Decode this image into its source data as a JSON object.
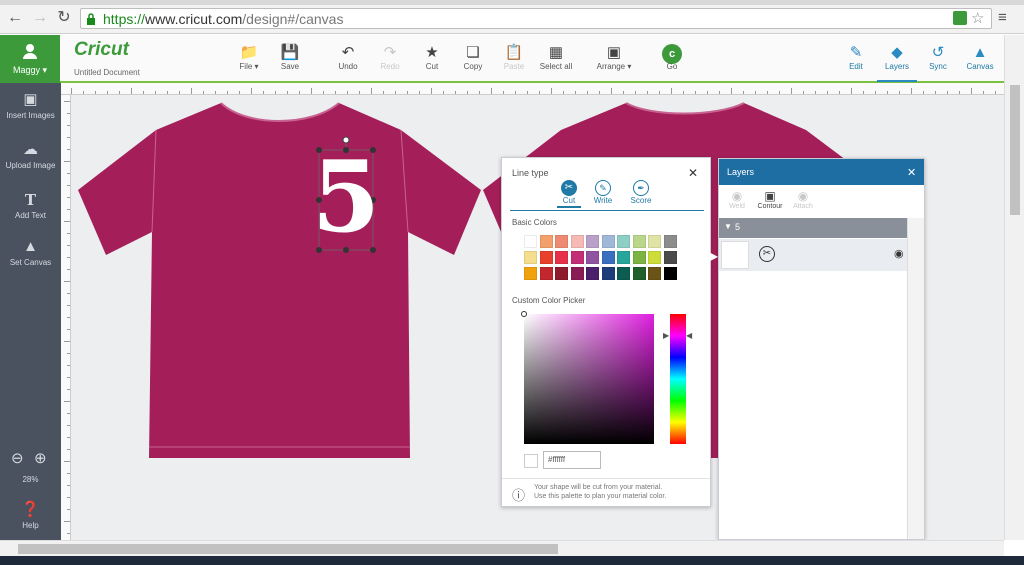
{
  "browser": {
    "back_icon": "back-arrow-icon",
    "forward_icon": "forward-arrow-icon",
    "reload_icon": "reload-icon",
    "url_scheme": "https://",
    "url_host": "www.cricut.com",
    "url_path": "/design#/canvas"
  },
  "header": {
    "user_name": "Maggy",
    "logo": "Cricut",
    "document_title": "Untitled Document",
    "toolbar": [
      {
        "label": "File",
        "icon": "folder-icon"
      },
      {
        "label": "Save",
        "icon": "save-icon"
      },
      {
        "label": "Undo",
        "icon": "undo-icon"
      },
      {
        "label": "Redo",
        "icon": "redo-icon"
      },
      {
        "label": "Cut",
        "icon": "cut-icon"
      },
      {
        "label": "Copy",
        "icon": "copy-icon"
      },
      {
        "label": "Paste",
        "icon": "paste-icon"
      },
      {
        "label": "Select all",
        "icon": "select-all-icon"
      },
      {
        "label": "Arrange",
        "icon": "arrange-icon"
      },
      {
        "label": "Go",
        "icon": "go-icon"
      }
    ],
    "right_tabs": [
      {
        "label": "Edit",
        "icon": "edit-icon"
      },
      {
        "label": "Layers",
        "icon": "layers-icon"
      },
      {
        "label": "Sync",
        "icon": "sync-icon"
      },
      {
        "label": "Canvas",
        "icon": "canvas-shirt-icon"
      }
    ]
  },
  "left_rail": [
    {
      "label": "Insert Images",
      "icon": "image-icon"
    },
    {
      "label": "Upload Image",
      "icon": "upload-icon"
    },
    {
      "label": "Add Text",
      "icon": "text-icon"
    },
    {
      "label": "Set Canvas",
      "icon": "shirt-icon"
    }
  ],
  "zoom": {
    "level": "28%"
  },
  "help_label": "Help",
  "design": {
    "number": "5",
    "shirt_color": "#a41f59"
  },
  "linetype_panel": {
    "title": "Line type",
    "options": [
      "Cut",
      "Write",
      "Score"
    ],
    "basic_colors_label": "Basic Colors",
    "custom_color_label": "Custom Color Picker",
    "hex_value": "#ffffff",
    "info_text_1": "Your shape will be cut from your material.",
    "info_text_2": "Use this palette to plan your material color.",
    "swatches": [
      "#ffffff",
      "#f4a06b",
      "#ee8a72",
      "#f6b9b4",
      "#b9a0c9",
      "#9fb8d8",
      "#8ecfc5",
      "#b9d68a",
      "#dfe3a4",
      "#8c8c8c",
      "#f4de8e",
      "#e8402b",
      "#e7314b",
      "#c32e77",
      "#8f53a1",
      "#3a6ebf",
      "#26a69a",
      "#7cb342",
      "#cddc39",
      "#4a4a4a",
      "#f0a20e",
      "#c1272d",
      "#8e1c2c",
      "#8a1c55",
      "#4a1f6b",
      "#1c3d7a",
      "#0d5c52",
      "#1f5f2a",
      "#6b5316",
      "#000000"
    ]
  },
  "layers_panel": {
    "title": "Layers",
    "actions": [
      "Weld",
      "Contour",
      "Attach"
    ],
    "group_label": "5"
  }
}
